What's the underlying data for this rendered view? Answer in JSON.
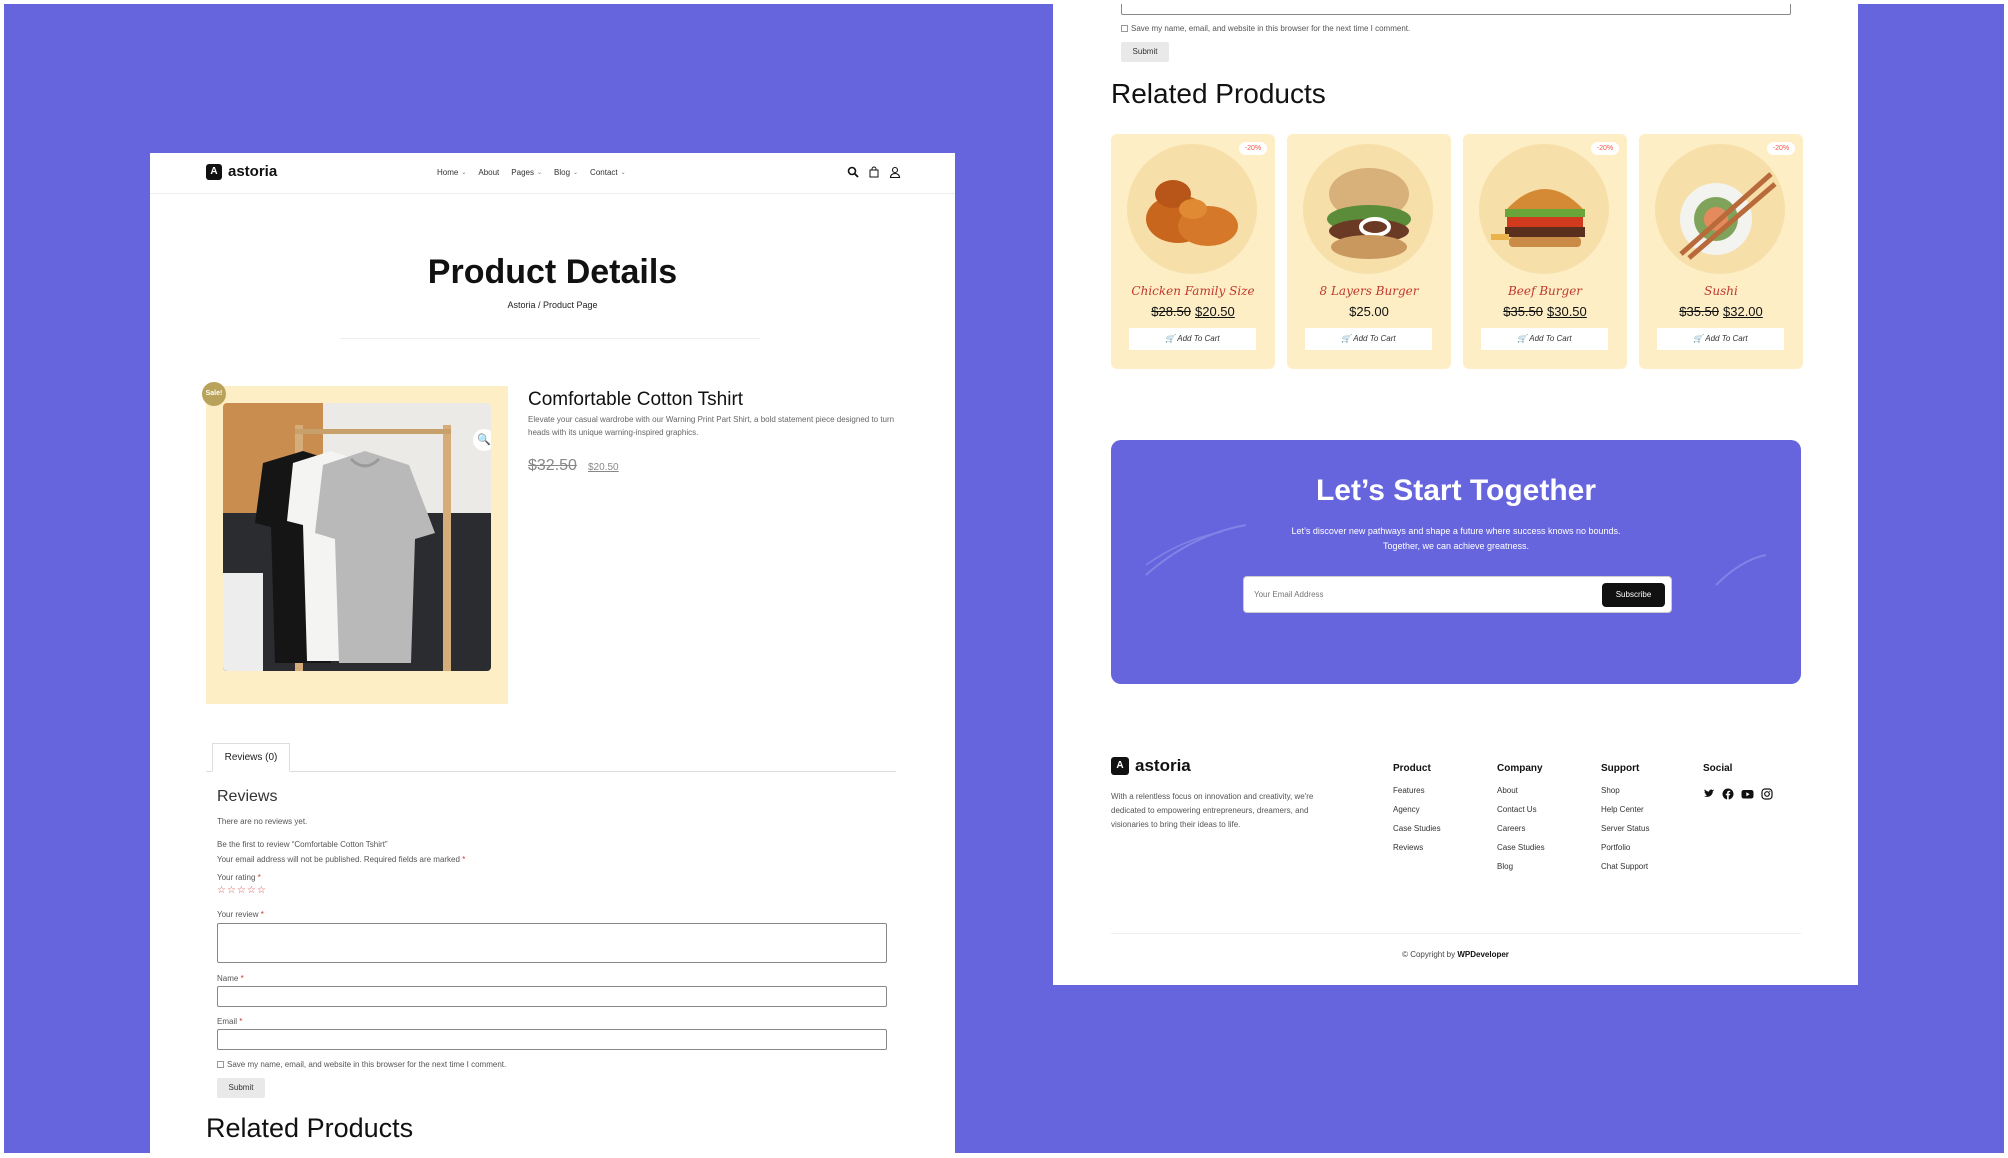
{
  "left": {
    "logo": "astoria",
    "nav": [
      {
        "label": "Home",
        "caret": true
      },
      {
        "label": "About",
        "caret": false
      },
      {
        "label": "Pages",
        "caret": true
      },
      {
        "label": "Blog",
        "caret": true
      },
      {
        "label": "Contact",
        "caret": true
      }
    ],
    "page_title": "Product Details",
    "breadcrumb": "Astoria / Product Page",
    "sale_badge": "Sale!",
    "product": {
      "name": "Comfortable Cotton Tshirt",
      "description": "Elevate your casual wardrobe with our Warning Print Part Shirt, a bold statement piece designed to turn heads with its unique warning-inspired graphics.",
      "price_old": "$32.50",
      "price_new": "$20.50"
    },
    "tab_reviews": "Reviews (0)",
    "reviews": {
      "heading": "Reviews",
      "none": "There are no reviews yet.",
      "first": "Be the first to review “Comfortable Cotton Tshirt”",
      "note": "Your email address will not be published. Required fields are marked",
      "rating_label": "Your rating",
      "stars": "☆☆☆☆☆",
      "review_label": "Your review",
      "name_label": "Name",
      "email_label": "Email",
      "save_label": "Save my name, email, and website in this browser for the next time I comment.",
      "submit": "Submit",
      "required_mark": "*"
    },
    "related_title": "Related Products"
  },
  "right": {
    "save_label": "Save my name, email, and website in this browser for the next time I comment.",
    "submit": "Submit",
    "related_title": "Related Products",
    "products": [
      {
        "name": "Chicken Family Size",
        "old": "$28.50",
        "new": "$20.50",
        "badge": "-20%",
        "add": "Add To Cart"
      },
      {
        "name": "8 Layers Burger",
        "old": "",
        "new": "$25.00",
        "badge": "",
        "add": "Add To Cart"
      },
      {
        "name": "Beef Burger",
        "old": "$35.50",
        "new": "$30.50",
        "badge": "-20%",
        "add": "Add To Cart"
      },
      {
        "name": "Sushi",
        "old": "$35.50",
        "new": "$32.00",
        "badge": "-20%",
        "add": "Add To Cart"
      }
    ],
    "cta": {
      "title": "Let’s Start Together",
      "text": "Let’s discover new pathways and shape a future where success knows no bounds. Together, we can achieve greatness.",
      "placeholder": "Your Email Address",
      "button": "Subscribe"
    },
    "footer": {
      "logo": "astoria",
      "about": "With a relentless focus on innovation and creativity, we're dedicated to empowering entrepreneurs, dreamers, and visionaries to bring their ideas to life.",
      "columns": [
        {
          "title": "Product",
          "links": [
            "Features",
            "Agency",
            "Case Studies",
            "Reviews"
          ]
        },
        {
          "title": "Company",
          "links": [
            "About",
            "Contact Us",
            "Careers",
            "Case Studies",
            "Blog"
          ]
        },
        {
          "title": "Support",
          "links": [
            "Shop",
            "Help Center",
            "Server Status",
            "Portfolio",
            "Chat Support"
          ]
        }
      ],
      "social_title": "Social",
      "copyright": "© Copyright by",
      "copyright_brand": "WPDeveloper"
    }
  },
  "colors": {
    "background": "#6665dd",
    "card": "#fdeec6",
    "accent": "#c0392b"
  }
}
